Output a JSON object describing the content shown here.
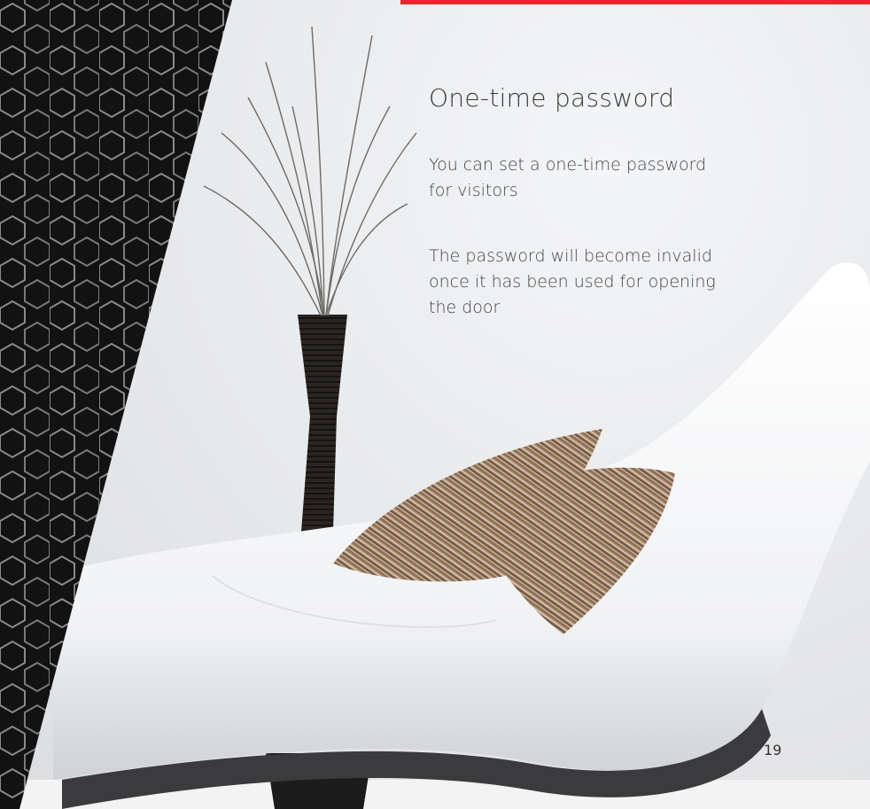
{
  "section": {
    "title": "One-time password",
    "paragraphs": [
      "You can set a one-time password for visitors",
      "The password will become invalid once it has been used for opening the door"
    ]
  },
  "page_number": "19",
  "colors": {
    "accent": "#e8262c",
    "dark_panel": "#141414",
    "text": "#3a3a3a"
  },
  "image": {
    "description_icon": "interior-photo-lounge-chair-vase-pillows"
  }
}
